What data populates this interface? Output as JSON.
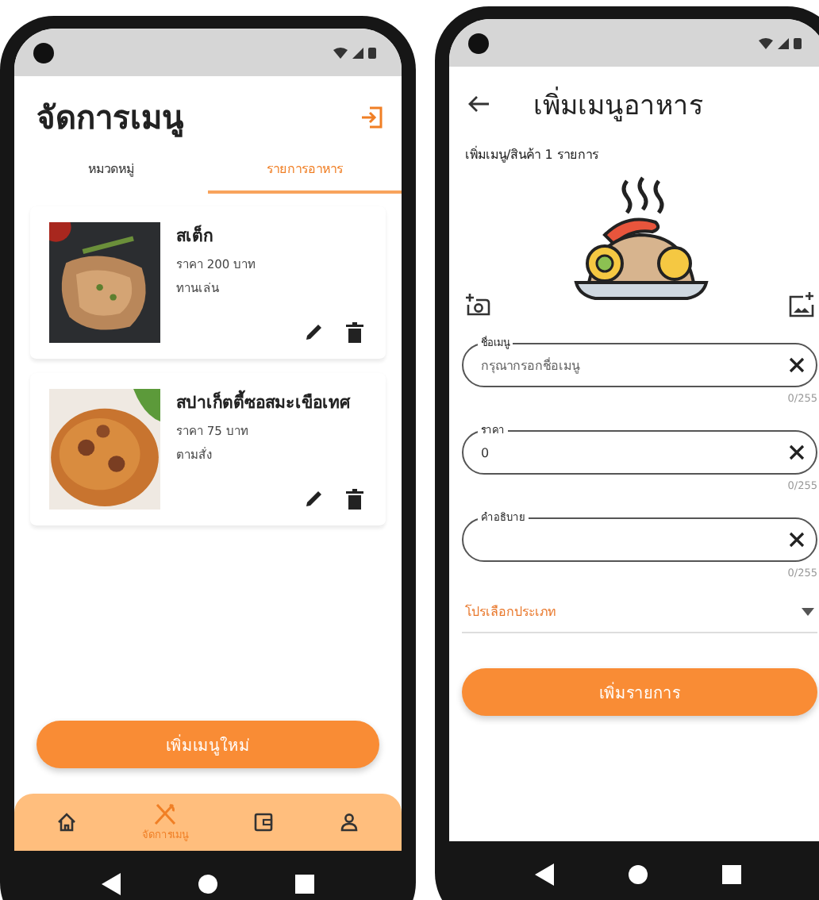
{
  "left_screen": {
    "title": "จัดการเมนู",
    "tabs": [
      {
        "label": "หมวดหมู่",
        "selected": false
      },
      {
        "label": "รายการอาหาร",
        "selected": true
      }
    ],
    "menu_items": [
      {
        "name": "สเต็ก",
        "price": "ราคา 200 บาท",
        "category": "ทานเล่น"
      },
      {
        "name": "สปาเก็ตตี้ซอสมะเขือเทศ",
        "price": "ราคา 75 บาท",
        "category": "ตามสั่ง"
      }
    ],
    "add_button": "เพิ่มเมนูใหม่",
    "bottom_nav": [
      {
        "selected": false
      },
      {
        "label": "จัดการเมนู",
        "selected": true
      },
      {
        "selected": false
      },
      {
        "selected": false
      }
    ]
  },
  "right_screen": {
    "title": "เพิ่มเมนูอาหาร",
    "subtitle": "เพิ่มเมนู/สินค้า 1 รายการ",
    "fields": [
      {
        "label": "ชื่อเมนู",
        "placeholder": "กรุณากรอกชื่อเมนู",
        "counter": "0/255"
      },
      {
        "label": "ราคา",
        "value": "0",
        "counter": "0/255"
      },
      {
        "label": "คำอธิบาย",
        "counter": "0/255"
      }
    ],
    "dropdown": {
      "placeholder": "โปรเลือกประเภท"
    },
    "submit_button": "เพิ่มรายการ"
  }
}
